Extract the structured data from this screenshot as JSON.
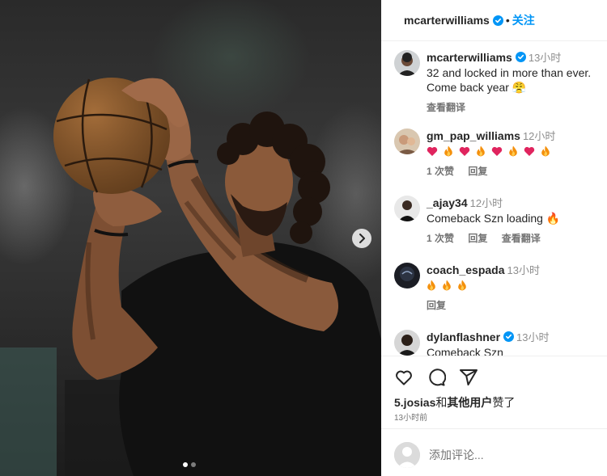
{
  "post": {
    "author": "mcarterwilliams",
    "follow_label": "关注",
    "separator": "•",
    "carousel": {
      "dots": 2,
      "active_index": 0
    }
  },
  "comments": [
    {
      "user": "mcarterwilliams",
      "verified": true,
      "time": "13小时",
      "text": "32 and locked in more than ever. Come back year 😤",
      "actions": [
        "查看翻译"
      ]
    },
    {
      "user": "gm_pap_williams",
      "verified": false,
      "time": "12小时",
      "text": "❤️🔥❤️🔥❤️🔥❤️🔥",
      "actions": [
        "1 次赞",
        "回复"
      ]
    },
    {
      "user": "_ajay34",
      "verified": false,
      "time": "12小时",
      "text": "Comeback Szn loading 🔥",
      "actions": [
        "1 次赞",
        "回复",
        "查看翻译"
      ]
    },
    {
      "user": "coach_espada",
      "verified": false,
      "time": "13小时",
      "text": "🔥🔥🔥",
      "actions": [
        "回复"
      ]
    },
    {
      "user": "dylanflashner",
      "verified": true,
      "time": "13小时",
      "text": "Comeback Szn",
      "actions": []
    }
  ],
  "footer": {
    "icons": [
      "heart-icon",
      "comment-icon",
      "share-icon"
    ],
    "likes_user": "5.josias",
    "likes_and": "和",
    "likes_others": "其他用户",
    "likes_suffix": "赞了",
    "time": "13小时前",
    "comment_placeholder": "添加评论..."
  },
  "colors": {
    "accent": "#0095f6",
    "verified": "#0095f6",
    "heart_red": "#e0245e",
    "fire_orange": "#f4900c"
  }
}
